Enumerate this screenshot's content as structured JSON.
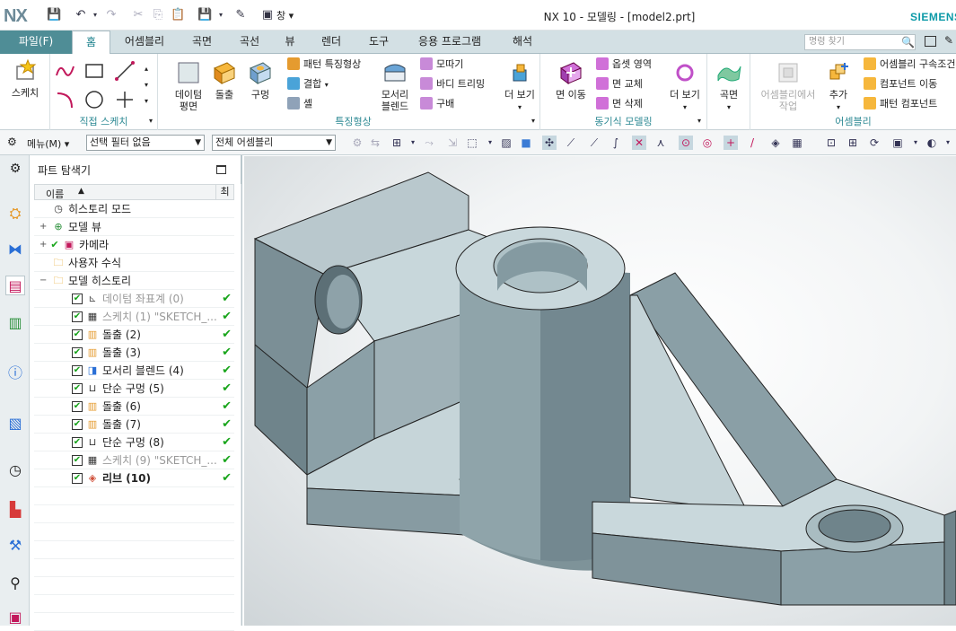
{
  "app": {
    "logo": "NX",
    "window_title": "NX 10 - 모델링 - [model2.prt]",
    "brand": "SIEMENS",
    "window_menu": "창 ▾"
  },
  "tabs": [
    {
      "label": "파일(F)"
    },
    {
      "label": "홈"
    },
    {
      "label": "어셈블리"
    },
    {
      "label": "곡면"
    },
    {
      "label": "곡선"
    },
    {
      "label": "뷰"
    },
    {
      "label": "렌더"
    },
    {
      "label": "도구"
    },
    {
      "label": "응용 프로그램"
    },
    {
      "label": "해석"
    }
  ],
  "command_search": {
    "placeholder": "명령 찾기"
  },
  "ribbon": {
    "sketch": {
      "label": "스케치"
    },
    "direct_sketch": {
      "label": "직접 스케치"
    },
    "features": {
      "label": "특징형상",
      "datum_plane": "데이텀\n평면",
      "extrude": "돌출",
      "hole": "구멍",
      "edge_blend": "모서리\n블렌드",
      "pattern_feature": "패턴 특징형상",
      "unite": "결합",
      "shell": "셸",
      "chamfer": "모따기",
      "body_trim": "바디 트리밍",
      "draft": "구배",
      "more": "더 보기"
    },
    "sync": {
      "label": "동기식 모델링",
      "move_face": "면 이동",
      "offset_region": "옵셋 영역",
      "replace_face": "면 교체",
      "delete_face": "면 삭제",
      "more": "더 보기"
    },
    "surface": {
      "label": "곡면"
    },
    "assembly": {
      "label": "어셈블리",
      "work_in_assembly": "어셈블리에서\n작업",
      "add": "추가",
      "assembly_constraints": "어셈블리 구속조건",
      "move_component": "컴포넌트 이동",
      "pattern_component": "패턴 컴포넌트"
    }
  },
  "selection_bar": {
    "menu": "메뉴(M) ▾",
    "filter": "선택 필터 없음",
    "scope": "전체 어셈블리"
  },
  "navigator": {
    "title": "파트 탐색기",
    "col_name": "이름",
    "col_latest": "최",
    "rows": [
      {
        "label": "히스토리 모드",
        "indent": 0,
        "icon": "clock",
        "checkbox": false,
        "latest": false,
        "dim": false,
        "bold": false
      },
      {
        "label": "모델 뷰",
        "indent": 0,
        "icon": "model-view",
        "checkbox": false,
        "latest": false,
        "expander": "+",
        "dim": false,
        "bold": false
      },
      {
        "label": "카메라",
        "indent": 0,
        "icon": "camera",
        "checkbox": false,
        "latest": false,
        "expander": "+",
        "check_mark": true,
        "dim": false,
        "bold": false
      },
      {
        "label": "사용자 수식",
        "indent": 0,
        "icon": "folder",
        "checkbox": false,
        "latest": false,
        "dim": false,
        "bold": false
      },
      {
        "label": "모델 히스토리",
        "indent": 0,
        "icon": "folder",
        "checkbox": false,
        "latest": false,
        "expander": "−",
        "dim": false,
        "bold": false
      },
      {
        "label": "데이텀 좌표계 (0)",
        "indent": 1,
        "icon": "datum-csys",
        "checkbox": true,
        "latest": true,
        "dim": true,
        "bold": false
      },
      {
        "label": "스케치 (1) \"SKETCH_...",
        "indent": 1,
        "icon": "sketch",
        "checkbox": true,
        "latest": true,
        "dim": true,
        "bold": false
      },
      {
        "label": "돌출 (2)",
        "indent": 1,
        "icon": "extrude",
        "checkbox": true,
        "latest": true,
        "dim": false,
        "bold": false
      },
      {
        "label": "돌출 (3)",
        "indent": 1,
        "icon": "extrude",
        "checkbox": true,
        "latest": true,
        "dim": false,
        "bold": false
      },
      {
        "label": "모서리 블렌드 (4)",
        "indent": 1,
        "icon": "edge-blend",
        "checkbox": true,
        "latest": true,
        "dim": false,
        "bold": false
      },
      {
        "label": "단순 구멍 (5)",
        "indent": 1,
        "icon": "hole",
        "checkbox": true,
        "latest": true,
        "dim": false,
        "bold": false
      },
      {
        "label": "돌출 (6)",
        "indent": 1,
        "icon": "extrude",
        "checkbox": true,
        "latest": true,
        "dim": false,
        "bold": false
      },
      {
        "label": "돌출 (7)",
        "indent": 1,
        "icon": "extrude",
        "checkbox": true,
        "latest": true,
        "dim": false,
        "bold": false
      },
      {
        "label": "단순 구멍 (8)",
        "indent": 1,
        "icon": "hole",
        "checkbox": true,
        "latest": true,
        "dim": false,
        "bold": false
      },
      {
        "label": "스케치 (9) \"SKETCH_...",
        "indent": 1,
        "icon": "sketch",
        "checkbox": true,
        "latest": true,
        "dim": true,
        "bold": false
      },
      {
        "label": "리브 (10)",
        "indent": 1,
        "icon": "rib",
        "checkbox": true,
        "latest": true,
        "dim": false,
        "bold": true
      }
    ]
  },
  "colors": {
    "file_tab": "#4f8d96",
    "tab_bar": "#d3e0e4",
    "group_label": "#2e8a94",
    "brand": "#0d9aa8",
    "latest_check": "#18a51b",
    "model_face_light": "#c9d8dc",
    "model_face_dark": "#7f949b"
  }
}
